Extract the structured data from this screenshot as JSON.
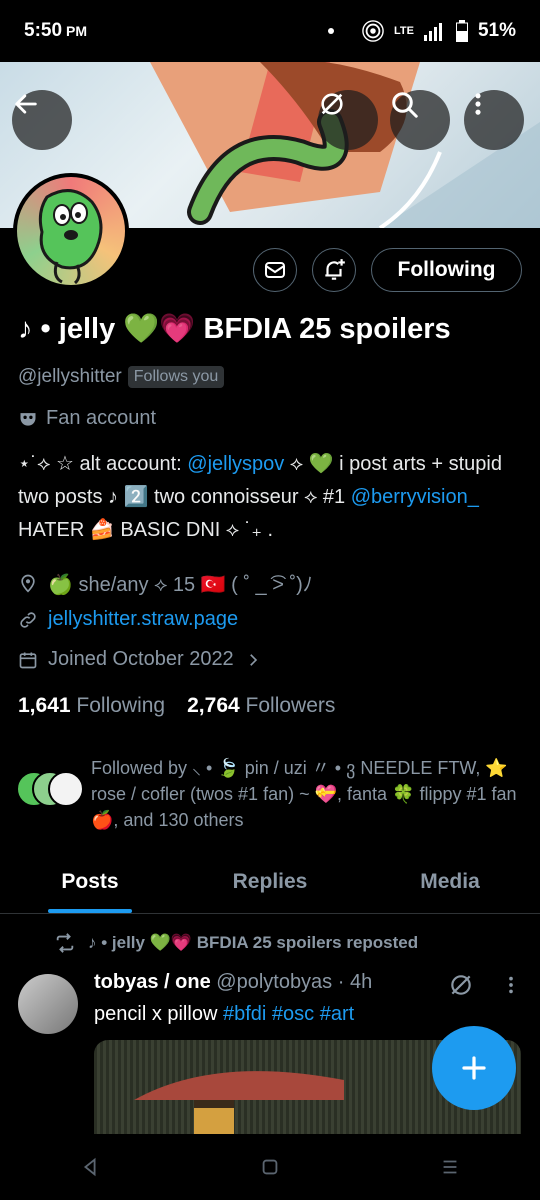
{
  "status": {
    "time": "5:50",
    "ampm": "PM",
    "network": "LTE",
    "battery": "51%"
  },
  "profile": {
    "display_name": "♪ • jelly 💚💗 BFDIA 25 spoilers",
    "handle": "@jellyshitter",
    "follows_you": "Follows you",
    "category": "Fan account",
    "bio": {
      "p1": "⋆˙⟡ ☆ alt account: ",
      "link1": "@jellyspov",
      "p2": " ⟡ 💚 i post arts + stupid two posts ♪ 2️⃣ two connoisseur ⟡ #1 ",
      "link2": "@berryvision_",
      "p3": " HATER  🍰 BASIC DNI ⟡ ˙₊ ."
    },
    "location": "🍏 she/any ⟡ 15 🇹🇷 ( ˚ _ ͡> ˚)ﾉ",
    "website": "jellyshitter.straw.page",
    "joined": "Joined October 2022",
    "following_count": "1,641",
    "following_label": "Following",
    "followers_count": "2,764",
    "followers_label": "Followers",
    "followed_by": "Followed by ⸜ • 🍃 pin / uzi 〃 • ვ NEEDLE FTW, ⭐ rose / cofler (twos #1 fan) ~ 💝, fanta 🍀 flippy #1 fan 🍎, and 130 others",
    "follow_button": "Following"
  },
  "tabs": [
    {
      "label": "Posts"
    },
    {
      "label": "Replies"
    },
    {
      "label": "Media"
    }
  ],
  "post": {
    "repost_label": "♪ • jelly 💚💗 BFDIA 25 spoilers reposted",
    "author_name": "tobyas / one",
    "author_handle": "@polytobyas",
    "time": "· 4h",
    "text": "pencil x pillow ",
    "tags": [
      "#bfdi",
      "#osc",
      "#art"
    ]
  },
  "icons": {
    "back": "back-arrow-icon",
    "hide": "eye-slash-icon",
    "search": "search-icon",
    "more": "more-vertical-icon",
    "message": "mail-icon",
    "notify": "bell-plus-icon",
    "category": "mask-icon",
    "location": "location-pin-icon",
    "link": "link-icon",
    "calendar": "calendar-icon",
    "repost": "repost-icon",
    "compose": "plus-icon"
  },
  "colors": {
    "accent": "#1d9bf0",
    "background": "#000000",
    "muted": "#8b98a5"
  }
}
